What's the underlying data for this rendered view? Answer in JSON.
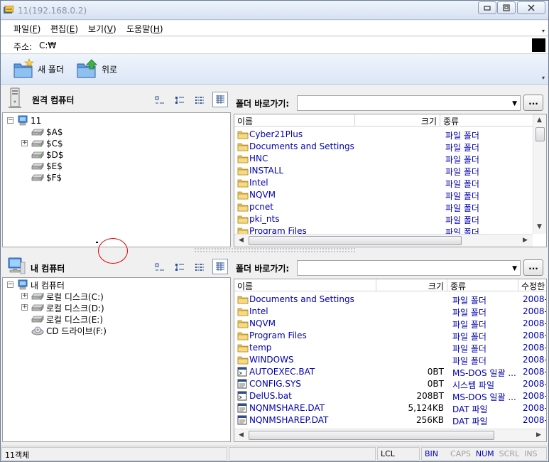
{
  "window": {
    "title": "11(192.168.0.2)"
  },
  "menubar": {
    "items": [
      {
        "label": "파일(",
        "key": "F",
        "end": ")"
      },
      {
        "label": "편집(",
        "key": "E",
        "end": ")"
      },
      {
        "label": "보기(",
        "key": "V",
        "end": ")"
      },
      {
        "label": "도움말(",
        "key": "H",
        "end": ")"
      }
    ]
  },
  "address": {
    "label": "주소:",
    "value": "C:₩"
  },
  "toolbar": {
    "new_folder": "새 폴더",
    "up": "위로"
  },
  "remote": {
    "title": "원격 컴퓨터",
    "shortcut_label": "폴더 바로가기:",
    "shortcut_button": "...",
    "tree": [
      {
        "label": "11",
        "level": 0,
        "expander": "−",
        "icon": "computer-icon"
      },
      {
        "label": "$A$",
        "level": 1,
        "expander": "",
        "icon": "drive-icon"
      },
      {
        "label": "$C$",
        "level": 1,
        "expander": "+",
        "icon": "drive-icon"
      },
      {
        "label": "$D$",
        "level": 1,
        "expander": "",
        "icon": "drive-icon"
      },
      {
        "label": "$E$",
        "level": 1,
        "expander": "",
        "icon": "drive-icon"
      },
      {
        "label": "$F$",
        "level": 1,
        "expander": "",
        "icon": "drive-icon"
      }
    ],
    "columns": {
      "name": "이름",
      "size": "크기",
      "kind": "종류"
    },
    "files": [
      {
        "name": "Cyber21Plus",
        "kind": "파일 폴더"
      },
      {
        "name": "Documents and Settings",
        "kind": "파일 폴더"
      },
      {
        "name": "HNC",
        "kind": "파일 폴더"
      },
      {
        "name": "INSTALL",
        "kind": "파일 폴더"
      },
      {
        "name": "Intel",
        "kind": "파일 폴더"
      },
      {
        "name": "NQVM",
        "kind": "파일 폴더"
      },
      {
        "name": "pcnet",
        "kind": "파일 폴더"
      },
      {
        "name": "pki_nts",
        "kind": "파일 폴더"
      },
      {
        "name": "Program Files",
        "kind": "파일 폴더"
      }
    ]
  },
  "local": {
    "title": "내 컴퓨터",
    "shortcut_label": "폴더 바로가기:",
    "shortcut_button": "...",
    "tree": [
      {
        "label": "내 컴퓨터",
        "level": 0,
        "expander": "−",
        "icon": "computer-icon"
      },
      {
        "label": "로컬 디스크(C:)",
        "level": 1,
        "expander": "+",
        "icon": "drive-icon"
      },
      {
        "label": "로컬 디스크(D:)",
        "level": 1,
        "expander": "+",
        "icon": "drive-icon"
      },
      {
        "label": "로컬 디스크(E:)",
        "level": 1,
        "expander": "",
        "icon": "drive-icon"
      },
      {
        "label": "CD 드라이브(F:)",
        "level": 1,
        "expander": "",
        "icon": "cd-drive-icon"
      }
    ],
    "columns": {
      "name": "이름",
      "size": "크기",
      "kind": "종류",
      "modified": "수정한"
    },
    "files": [
      {
        "name": "Documents and Settings",
        "size": "",
        "kind": "파일 폴더",
        "modified": "2008-",
        "icon": "folder"
      },
      {
        "name": "Intel",
        "size": "",
        "kind": "파일 폴더",
        "modified": "2008-",
        "icon": "folder"
      },
      {
        "name": "NQVM",
        "size": "",
        "kind": "파일 폴더",
        "modified": "2008-",
        "icon": "folder"
      },
      {
        "name": "Program Files",
        "size": "",
        "kind": "파일 폴더",
        "modified": "2008-",
        "icon": "folder"
      },
      {
        "name": "temp",
        "size": "",
        "kind": "파일 폴더",
        "modified": "2008-",
        "icon": "folder"
      },
      {
        "name": "WINDOWS",
        "size": "",
        "kind": "파일 폴더",
        "modified": "2008-",
        "icon": "folder"
      },
      {
        "name": "AUTOEXEC.BAT",
        "size": "0BT",
        "kind": "MS-DOS 일괄 ...",
        "modified": "2008-",
        "icon": "batch"
      },
      {
        "name": "CONFIG.SYS",
        "size": "0BT",
        "kind": "시스템 파일",
        "modified": "2008-",
        "icon": "file"
      },
      {
        "name": "DelUS.bat",
        "size": "208BT",
        "kind": "MS-DOS 일괄 ...",
        "modified": "2008-",
        "icon": "batch"
      },
      {
        "name": "NQNMSHARE.DAT",
        "size": "5,124KB",
        "kind": "DAT 파일",
        "modified": "2008-",
        "icon": "file"
      },
      {
        "name": "NQNMSHAREP.DAT",
        "size": "256KB",
        "kind": "DAT 파일",
        "modified": "2008-",
        "icon": "file"
      }
    ]
  },
  "status": {
    "objects": "11객체",
    "lcl": "LCL",
    "bin": "BIN",
    "caps": "CAPS",
    "num": "NUM",
    "scrl": "SCRL",
    "ins": "INS"
  },
  "colors": {
    "link": "#0000b0",
    "dim": "#a0a0a0",
    "annotation": "#dd0000"
  }
}
